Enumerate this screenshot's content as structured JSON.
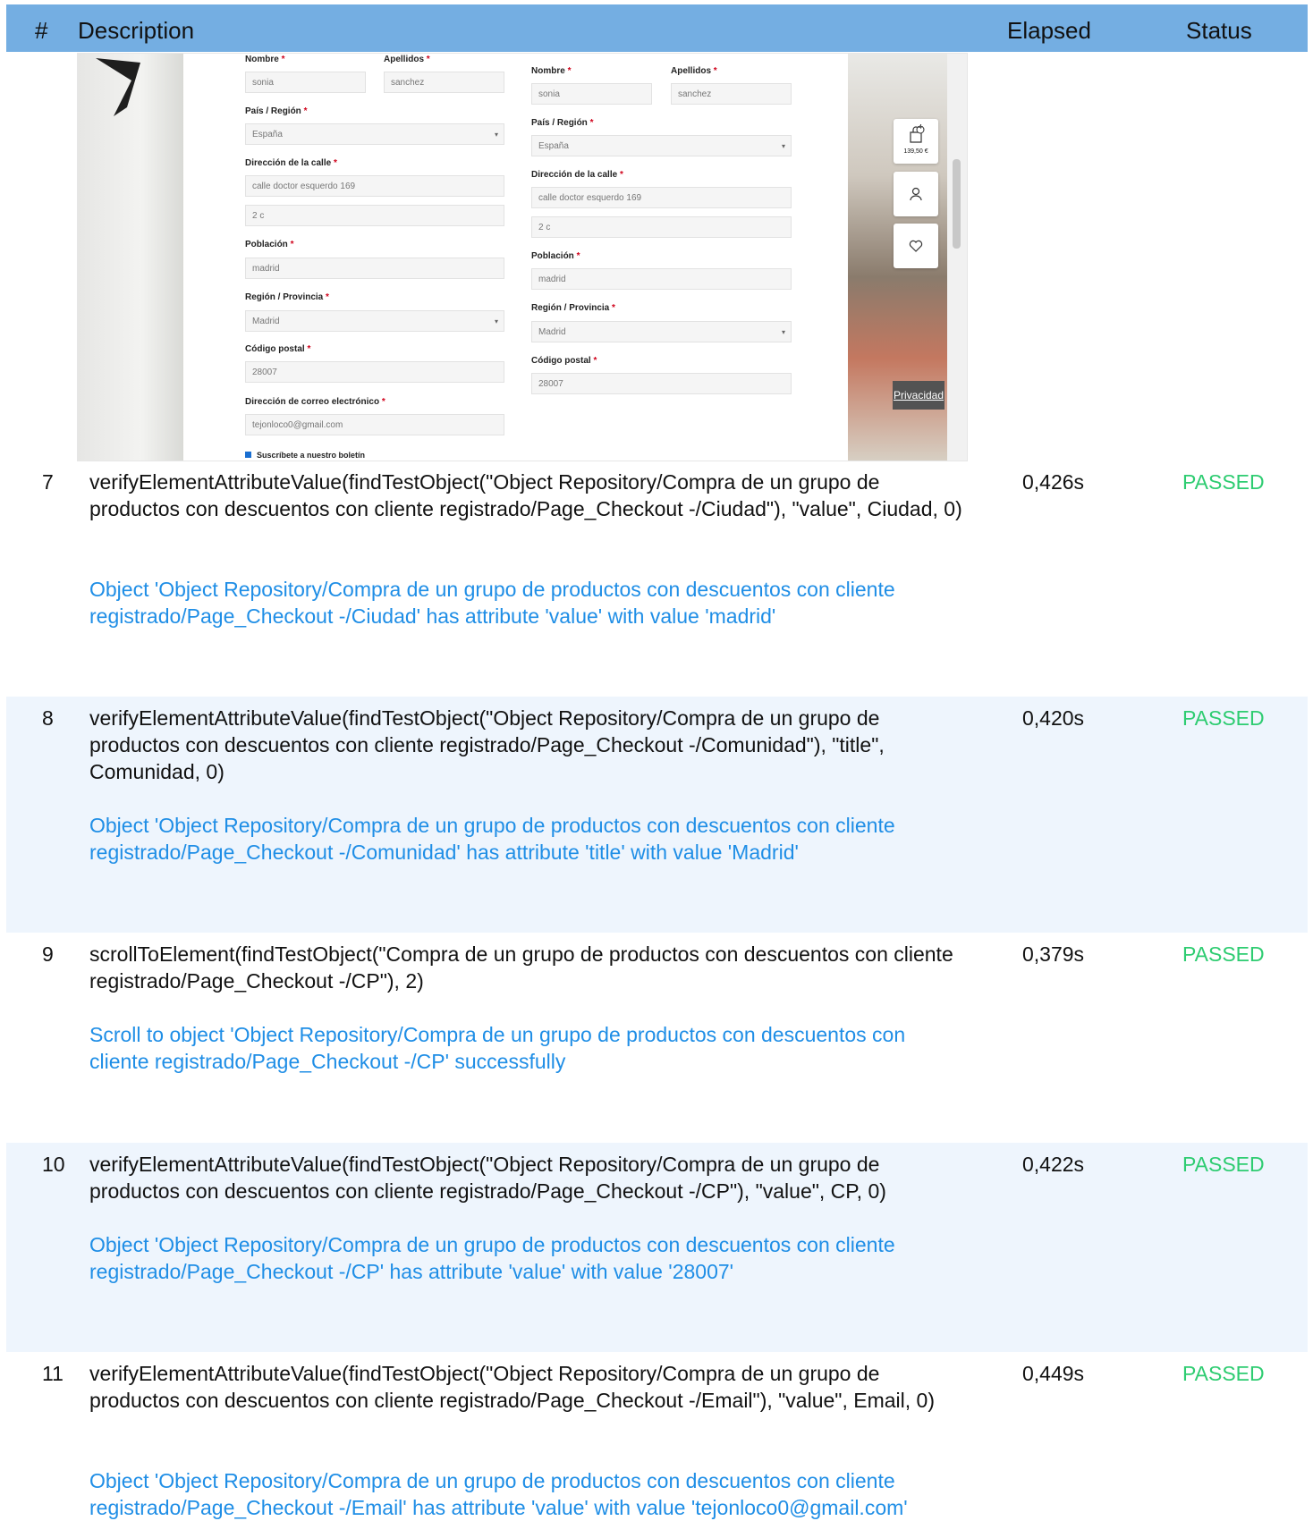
{
  "header": {
    "num": "#",
    "description": "Description",
    "elapsed": "Elapsed",
    "status": "Status"
  },
  "screenshot": {
    "form_a": {
      "nombre_label": "Nombre",
      "apellidos_label": "Apellidos",
      "nombre": "sonia",
      "apellidos": "sanchez",
      "pais_label": "País / Región",
      "pais": "España",
      "direccion_label": "Dirección de la calle",
      "direccion1": "calle doctor esquerdo 169",
      "direccion2": "2 c",
      "poblacion_label": "Población",
      "poblacion": "madrid",
      "region_label": "Región / Provincia",
      "region": "Madrid",
      "cp_label": "Código postal",
      "cp": "28007",
      "email_label": "Dirección de correo electrónico",
      "email": "tejonloco0@gmail.com",
      "newsletter": "Suscríbete a nuestro boletín"
    },
    "form_b": {
      "nombre_label": "Nombre",
      "apellidos_label": "Apellidos",
      "nombre": "sonia",
      "apellidos": "sanchez",
      "pais_label": "País / Región",
      "pais": "España",
      "direccion_label": "Dirección de la calle",
      "direccion1": "calle doctor esquerdo 169",
      "direccion2": "2 c",
      "poblacion_label": "Población",
      "poblacion": "madrid",
      "region_label": "Región / Provincia",
      "region": "Madrid",
      "cp_label": "Código postal",
      "cp": "28007"
    },
    "cart_count": "4",
    "cart_total": "139,50 €",
    "privacy": "Privacidad",
    "required_mark": "*"
  },
  "rows": [
    {
      "num": "7",
      "description": "verifyElementAttributeValue(findTestObject(\"Object Repository/Compra de un grupo de productos con descuentos con cliente registrado/Page_Checkout -/Ciudad\"), \"value\", Ciudad, 0)",
      "message": "Object 'Object Repository/Compra de un grupo de productos con descuentos con cliente registrado/Page_Checkout -/Ciudad' has attribute 'value' with value 'madrid'",
      "elapsed": "0,426s",
      "status": "PASSED"
    },
    {
      "num": "8",
      "description": "verifyElementAttributeValue(findTestObject(\"Object Repository/Compra de un grupo de productos con descuentos con cliente registrado/Page_Checkout -/Comunidad\"), \"title\", Comunidad, 0)",
      "message": "Object 'Object Repository/Compra de un grupo de productos con descuentos con cliente registrado/Page_Checkout -/Comunidad' has attribute 'title' with value 'Madrid'",
      "elapsed": "0,420s",
      "status": "PASSED"
    },
    {
      "num": "9",
      "description": "scrollToElement(findTestObject(\"Compra de un grupo de productos con descuentos con cliente registrado/Page_Checkout -/CP\"), 2)",
      "message": "Scroll to object 'Object Repository/Compra de un grupo de productos con descuentos con cliente registrado/Page_Checkout -/CP' successfully",
      "elapsed": "0,379s",
      "status": "PASSED"
    },
    {
      "num": "10",
      "description": "verifyElementAttributeValue(findTestObject(\"Object Repository/Compra de un grupo de productos con descuentos con cliente registrado/Page_Checkout -/CP\"), \"value\", CP, 0)",
      "message": "Object 'Object Repository/Compra de un grupo de productos con descuentos con cliente registrado/Page_Checkout -/CP' has attribute 'value' with value '28007'",
      "elapsed": "0,422s",
      "status": "PASSED"
    },
    {
      "num": "11",
      "description": "verifyElementAttributeValue(findTestObject(\"Object Repository/Compra de un grupo de productos con descuentos con cliente registrado/Page_Checkout -/Email\"), \"value\", Email, 0)",
      "message": "Object 'Object Repository/Compra de un grupo de productos con descuentos con cliente registrado/Page_Checkout -/Email' has attribute 'value' with value 'tejonloco0@gmail.com'",
      "elapsed": "0,449s",
      "status": "PASSED"
    }
  ],
  "colors": {
    "header_bg": "#74aee2",
    "passed": "#2ecc71",
    "message": "#1f8ee6",
    "row_alt": "#eef5fd"
  }
}
